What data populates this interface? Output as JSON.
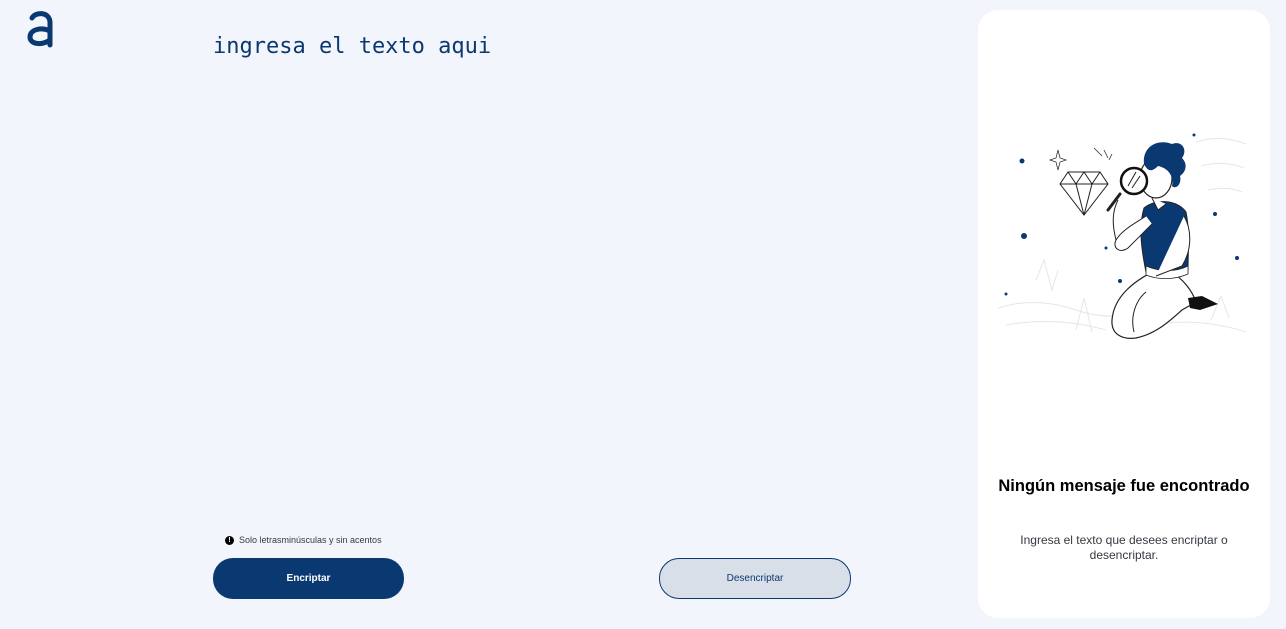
{
  "input": {
    "placeholder": "ingresa el texto aqui"
  },
  "hint": {
    "icon": "info-icon",
    "text": "Solo letrasminúsculas y sin acentos"
  },
  "buttons": {
    "encrypt_label": "Encriptar",
    "decrypt_label": "Desencriptar"
  },
  "output_panel": {
    "title": "Ningún mensaje fue encontrado",
    "description": "Ingresa el texto que desees encriptar o desencriptar.",
    "illustration": "person-with-magnifying-glass-illustration"
  },
  "colors": {
    "background": "#F3F5FC",
    "primary": "#0A3871",
    "secondary_button": "#D8DFE8",
    "panel": "#FFFFFF"
  }
}
